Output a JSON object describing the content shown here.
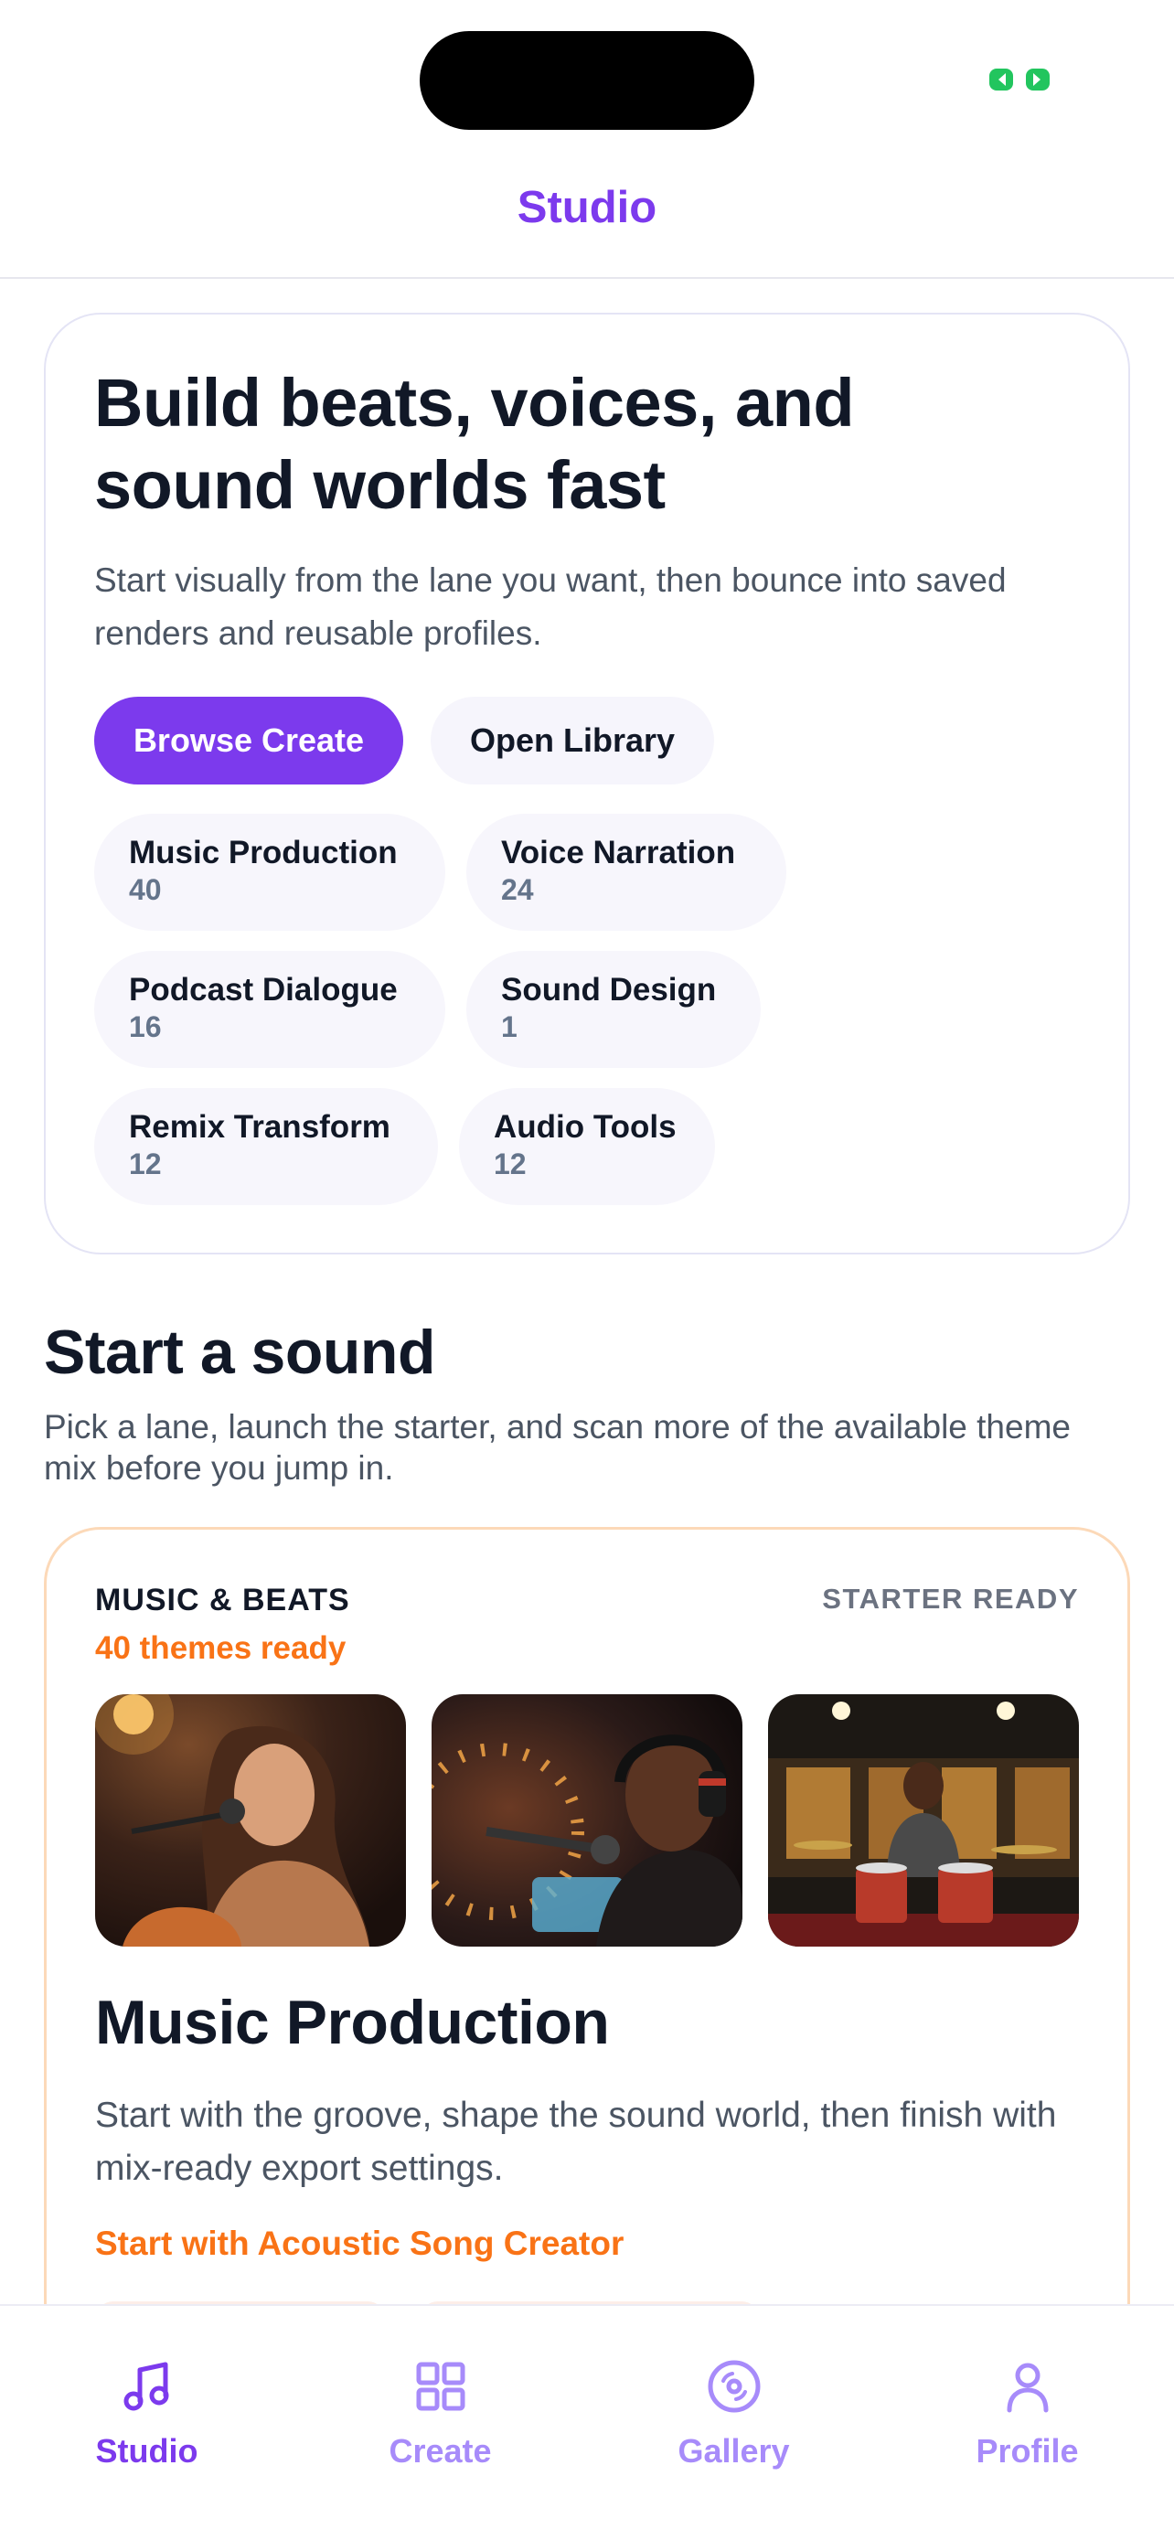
{
  "header": {
    "title": "Studio"
  },
  "hero": {
    "title": "Build beats, voices, and sound worlds fast",
    "description": "Start visually from the lane you want, then bounce into saved renders and reusable profiles.",
    "primary_button": "Browse Create",
    "secondary_button": "Open Library",
    "categories": [
      {
        "label": "Music Production",
        "count": "40"
      },
      {
        "label": "Voice Narration",
        "count": "24"
      },
      {
        "label": "Podcast Dialogue",
        "count": "16"
      },
      {
        "label": "Sound Design",
        "count": "1"
      },
      {
        "label": "Remix Transform",
        "count": "12"
      },
      {
        "label": "Audio Tools",
        "count": "12"
      }
    ]
  },
  "section": {
    "title": "Start a sound",
    "subtitle": "Pick a lane, launch the starter, and scan more of the available theme mix before you jump in."
  },
  "lane": {
    "kicker": "MUSIC & BEATS",
    "status": "STARTER READY",
    "themes": "40 themes ready",
    "thumbnails": [
      "singer-guitar-image",
      "singer-headphones-image",
      "drummer-studio-image"
    ],
    "title": "Music Production",
    "description": "Start with the groove, shape the sound world, then finish with mix-ready export settings.",
    "cta": "Start with Acoustic Song Creator"
  },
  "tabbar": {
    "tabs": [
      {
        "label": "Studio",
        "icon": "music-note-icon",
        "active": true
      },
      {
        "label": "Create",
        "icon": "grid-icon",
        "active": false
      },
      {
        "label": "Gallery",
        "icon": "disc-icon",
        "active": false
      },
      {
        "label": "Profile",
        "icon": "person-icon",
        "active": false
      }
    ]
  },
  "colors": {
    "accent": "#7c3aed",
    "accent_light": "#a78bfa",
    "orange": "#f97316",
    "battery": "#22c55e"
  }
}
